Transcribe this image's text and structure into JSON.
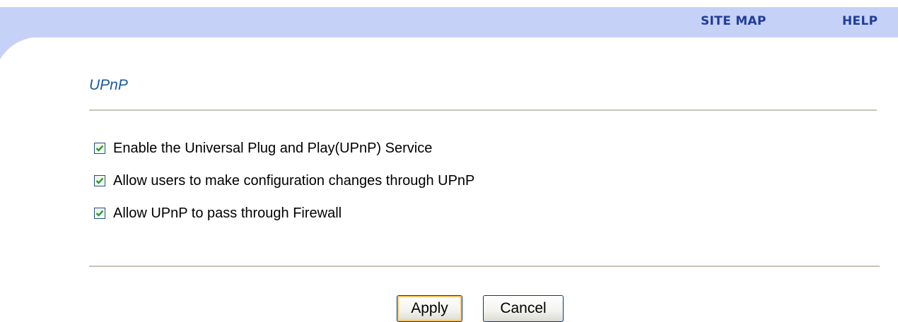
{
  "header": {
    "site_map_label": "SITE MAP",
    "help_label": "HELP",
    "band_color": "#c5d1f7",
    "link_color": "#1f3d9a"
  },
  "page": {
    "title": "UPnP"
  },
  "options": [
    {
      "label": "Enable the Universal Plug and Play(UPnP) Service",
      "checked": true
    },
    {
      "label": "Allow users to make configuration changes through UPnP",
      "checked": true
    },
    {
      "label": "Allow UPnP to pass through Firewall",
      "checked": true
    }
  ],
  "buttons": {
    "apply_label": "Apply",
    "cancel_label": "Cancel"
  },
  "icons": {
    "checkbox": "checkmark-icon"
  }
}
